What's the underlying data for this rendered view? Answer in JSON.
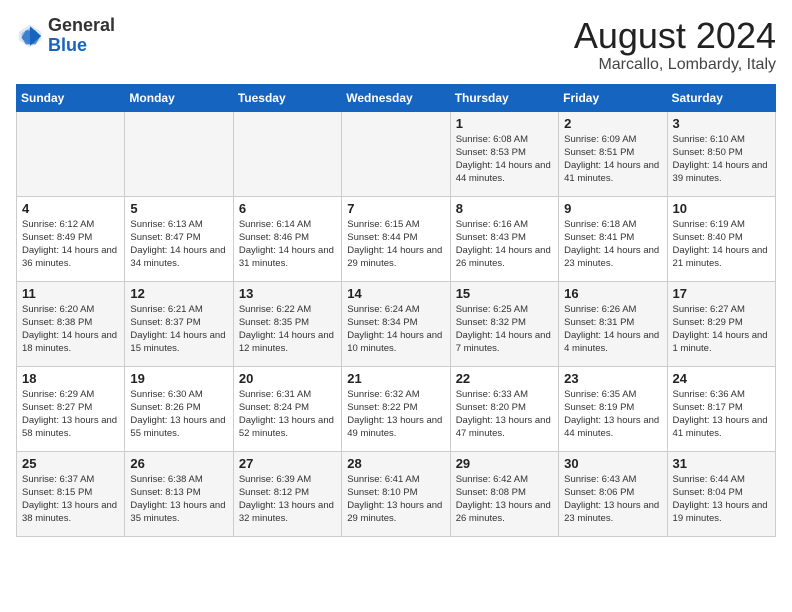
{
  "header": {
    "logo_general": "General",
    "logo_blue": "Blue",
    "month_year": "August 2024",
    "location": "Marcallo, Lombardy, Italy"
  },
  "days_of_week": [
    "Sunday",
    "Monday",
    "Tuesday",
    "Wednesday",
    "Thursday",
    "Friday",
    "Saturday"
  ],
  "weeks": [
    [
      {
        "day": "",
        "info": ""
      },
      {
        "day": "",
        "info": ""
      },
      {
        "day": "",
        "info": ""
      },
      {
        "day": "",
        "info": ""
      },
      {
        "day": "1",
        "info": "Sunrise: 6:08 AM\nSunset: 8:53 PM\nDaylight: 14 hours and 44 minutes."
      },
      {
        "day": "2",
        "info": "Sunrise: 6:09 AM\nSunset: 8:51 PM\nDaylight: 14 hours and 41 minutes."
      },
      {
        "day": "3",
        "info": "Sunrise: 6:10 AM\nSunset: 8:50 PM\nDaylight: 14 hours and 39 minutes."
      }
    ],
    [
      {
        "day": "4",
        "info": "Sunrise: 6:12 AM\nSunset: 8:49 PM\nDaylight: 14 hours and 36 minutes."
      },
      {
        "day": "5",
        "info": "Sunrise: 6:13 AM\nSunset: 8:47 PM\nDaylight: 14 hours and 34 minutes."
      },
      {
        "day": "6",
        "info": "Sunrise: 6:14 AM\nSunset: 8:46 PM\nDaylight: 14 hours and 31 minutes."
      },
      {
        "day": "7",
        "info": "Sunrise: 6:15 AM\nSunset: 8:44 PM\nDaylight: 14 hours and 29 minutes."
      },
      {
        "day": "8",
        "info": "Sunrise: 6:16 AM\nSunset: 8:43 PM\nDaylight: 14 hours and 26 minutes."
      },
      {
        "day": "9",
        "info": "Sunrise: 6:18 AM\nSunset: 8:41 PM\nDaylight: 14 hours and 23 minutes."
      },
      {
        "day": "10",
        "info": "Sunrise: 6:19 AM\nSunset: 8:40 PM\nDaylight: 14 hours and 21 minutes."
      }
    ],
    [
      {
        "day": "11",
        "info": "Sunrise: 6:20 AM\nSunset: 8:38 PM\nDaylight: 14 hours and 18 minutes."
      },
      {
        "day": "12",
        "info": "Sunrise: 6:21 AM\nSunset: 8:37 PM\nDaylight: 14 hours and 15 minutes."
      },
      {
        "day": "13",
        "info": "Sunrise: 6:22 AM\nSunset: 8:35 PM\nDaylight: 14 hours and 12 minutes."
      },
      {
        "day": "14",
        "info": "Sunrise: 6:24 AM\nSunset: 8:34 PM\nDaylight: 14 hours and 10 minutes."
      },
      {
        "day": "15",
        "info": "Sunrise: 6:25 AM\nSunset: 8:32 PM\nDaylight: 14 hours and 7 minutes."
      },
      {
        "day": "16",
        "info": "Sunrise: 6:26 AM\nSunset: 8:31 PM\nDaylight: 14 hours and 4 minutes."
      },
      {
        "day": "17",
        "info": "Sunrise: 6:27 AM\nSunset: 8:29 PM\nDaylight: 14 hours and 1 minute."
      }
    ],
    [
      {
        "day": "18",
        "info": "Sunrise: 6:29 AM\nSunset: 8:27 PM\nDaylight: 13 hours and 58 minutes."
      },
      {
        "day": "19",
        "info": "Sunrise: 6:30 AM\nSunset: 8:26 PM\nDaylight: 13 hours and 55 minutes."
      },
      {
        "day": "20",
        "info": "Sunrise: 6:31 AM\nSunset: 8:24 PM\nDaylight: 13 hours and 52 minutes."
      },
      {
        "day": "21",
        "info": "Sunrise: 6:32 AM\nSunset: 8:22 PM\nDaylight: 13 hours and 49 minutes."
      },
      {
        "day": "22",
        "info": "Sunrise: 6:33 AM\nSunset: 8:20 PM\nDaylight: 13 hours and 47 minutes."
      },
      {
        "day": "23",
        "info": "Sunrise: 6:35 AM\nSunset: 8:19 PM\nDaylight: 13 hours and 44 minutes."
      },
      {
        "day": "24",
        "info": "Sunrise: 6:36 AM\nSunset: 8:17 PM\nDaylight: 13 hours and 41 minutes."
      }
    ],
    [
      {
        "day": "25",
        "info": "Sunrise: 6:37 AM\nSunset: 8:15 PM\nDaylight: 13 hours and 38 minutes."
      },
      {
        "day": "26",
        "info": "Sunrise: 6:38 AM\nSunset: 8:13 PM\nDaylight: 13 hours and 35 minutes."
      },
      {
        "day": "27",
        "info": "Sunrise: 6:39 AM\nSunset: 8:12 PM\nDaylight: 13 hours and 32 minutes."
      },
      {
        "day": "28",
        "info": "Sunrise: 6:41 AM\nSunset: 8:10 PM\nDaylight: 13 hours and 29 minutes."
      },
      {
        "day": "29",
        "info": "Sunrise: 6:42 AM\nSunset: 8:08 PM\nDaylight: 13 hours and 26 minutes."
      },
      {
        "day": "30",
        "info": "Sunrise: 6:43 AM\nSunset: 8:06 PM\nDaylight: 13 hours and 23 minutes."
      },
      {
        "day": "31",
        "info": "Sunrise: 6:44 AM\nSunset: 8:04 PM\nDaylight: 13 hours and 19 minutes."
      }
    ]
  ]
}
